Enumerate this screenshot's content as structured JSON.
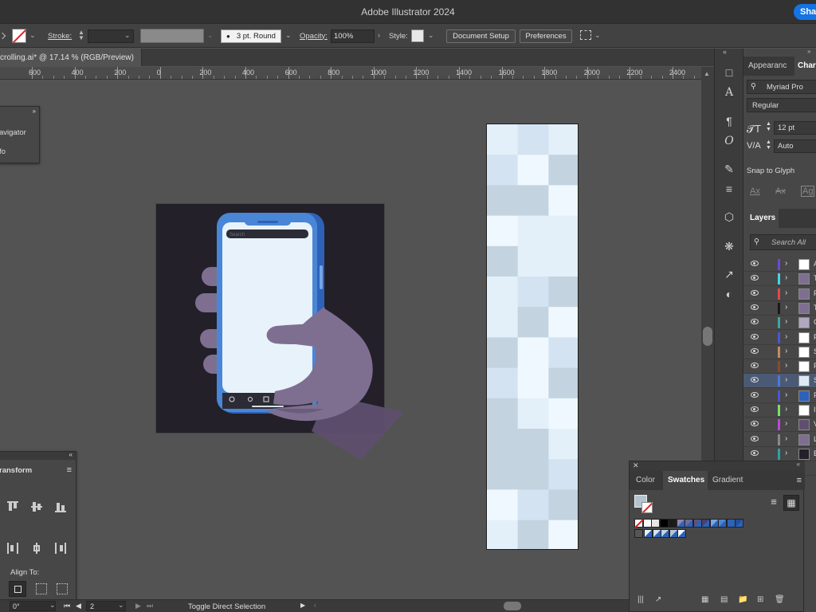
{
  "app": {
    "title": "Adobe Illustrator 2024",
    "share_label": "Share"
  },
  "control_bar": {
    "stroke_label": "Stroke:",
    "brush_value": "3 pt. Round",
    "opacity_label": "Opacity:",
    "opacity_value": "100%",
    "style_label": "Style:",
    "document_setup_label": "Document Setup",
    "preferences_label": "Preferences"
  },
  "document_tab": {
    "label": "crolling.ai* @ 17.14 % (RGB/Preview)"
  },
  "ruler": {
    "labels": [
      "600",
      "400",
      "200",
      "0",
      "200",
      "400",
      "600",
      "800",
      "1000",
      "1200",
      "1400",
      "1600",
      "1800",
      "2000",
      "2200",
      "2400"
    ]
  },
  "navigator_panel": {
    "items": [
      "avigator",
      "fo"
    ]
  },
  "transform_panel": {
    "title": "ransform",
    "align_to_label": "Align To:"
  },
  "status_bar": {
    "rotation": "0°",
    "artboard": "2",
    "status_text": "Toggle Direct Selection"
  },
  "phone_mockup": {
    "search_placeholder": "Search"
  },
  "right_panel": {
    "tabs": [
      "Appearanc",
      "Chara"
    ],
    "font_family": "Myriad Pro",
    "font_style": "Regular",
    "font_size": "12 pt",
    "leading": "Auto",
    "snap_to_glyph_label": "Snap to Glyph",
    "glyph_buttons": [
      "Ax",
      "Ax",
      "Ag"
    ]
  },
  "layers_panel": {
    "tab_label": "Layers",
    "search_placeholder": "Search All",
    "layer_names": [
      "A",
      "T",
      "F",
      "T",
      "C",
      "F",
      "S",
      "F",
      "S",
      "F",
      "I",
      "V",
      "L",
      "E"
    ],
    "layer_colors": [
      "#6a4bd8",
      "#43d6e8",
      "#e04848",
      "#1a1a1a",
      "#3aa9a0",
      "#4b55d6",
      "#c88a5a",
      "#8a4a2a",
      "#4b78e0",
      "#4b55d6",
      "#7ae06a",
      "#b84ad6",
      "#888888",
      "#2aa3a3",
      "#e08a2a"
    ],
    "selected_index": 8
  },
  "swatches_panel": {
    "tabs": [
      "Color",
      "Swatches",
      "Gradient"
    ]
  },
  "colors": {
    "accent": "#1473e6",
    "phone_body": "#4a86d6",
    "phone_screen": "#e8f2fb",
    "hand": "#7e6f91",
    "artboard_bg": "#232029",
    "tile_blues": [
      "#e3f0fa",
      "#d3e3f1",
      "#c3d3df",
      "#b8c7d0",
      "#eff8fe"
    ]
  }
}
